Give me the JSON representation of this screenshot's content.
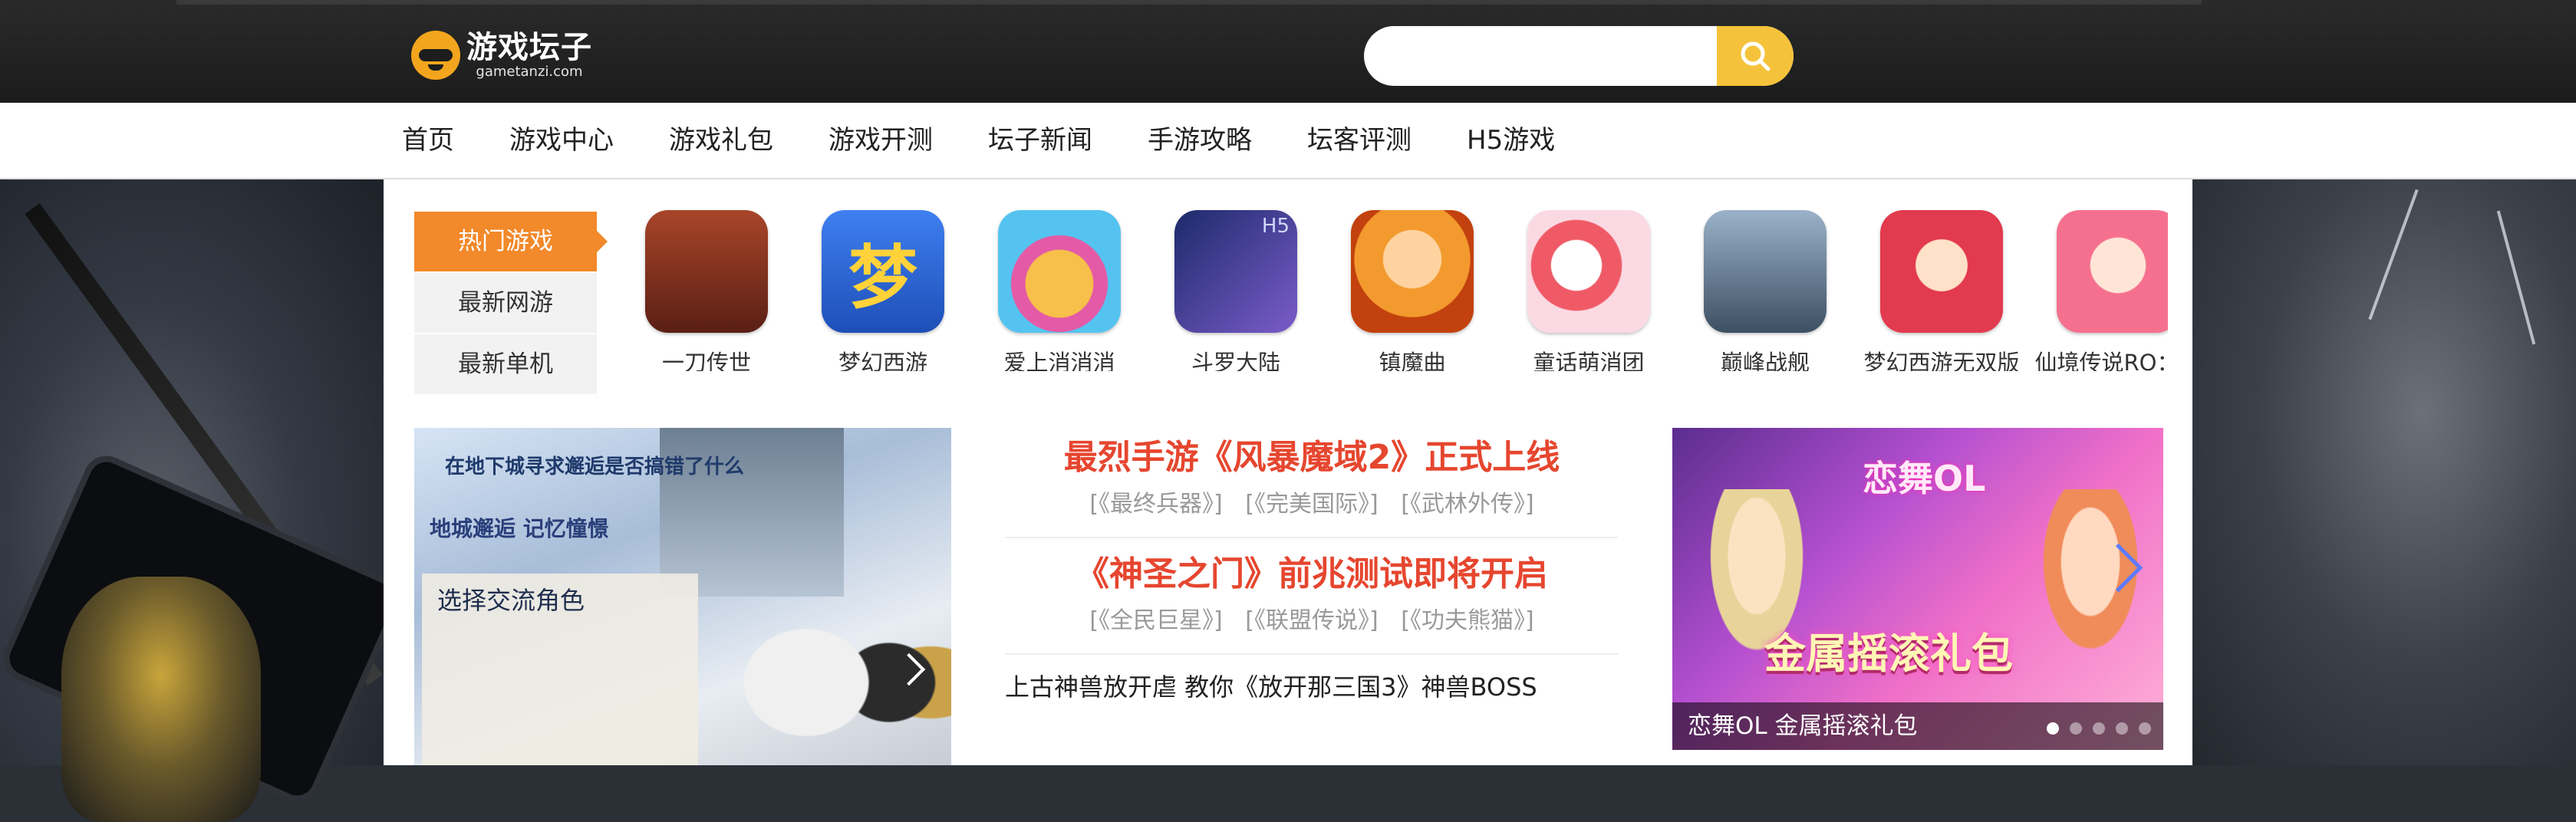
{
  "header": {
    "logo_cn": "游戏坛子",
    "logo_en": "gametanzi.com",
    "search_placeholder": ""
  },
  "nav": {
    "items": [
      "首页",
      "游戏中心",
      "游戏礼包",
      "游戏开测",
      "坛子新闻",
      "手游攻略",
      "坛客评测",
      "H5游戏"
    ]
  },
  "tabs": {
    "items": [
      "热门游戏",
      "最新网游",
      "最新单机"
    ],
    "active_index": 0
  },
  "games": [
    {
      "name": "一刀传世",
      "color": "#7a2b1a"
    },
    {
      "name": "梦幻西游",
      "color": "#2f67d6",
      "glyph": "梦"
    },
    {
      "name": "爱上消消消",
      "color": "#f3b93a"
    },
    {
      "name": "斗罗大陆",
      "color": "#3b3f8f",
      "badge": "H5"
    },
    {
      "name": "镇魔曲",
      "color": "#f08a25"
    },
    {
      "name": "童话萌消团",
      "color": "#f8d7e0"
    },
    {
      "name": "巅峰战舰",
      "color": "#4f6a86"
    },
    {
      "name": "梦幻西游无双版",
      "color": "#d9364c"
    },
    {
      "name": "仙境传说RO：守",
      "color": "#f48ca2"
    }
  ],
  "feature_image": {
    "line1": "在地下城寻求邂逅是否搞错了什么",
    "line2": "地城邂逅 记忆憧憬",
    "panel_title": "选择交流角色"
  },
  "news": {
    "headline1": "最烈手游《风暴魔域2》正式上线",
    "sub1": [
      "[《最终兵器》]",
      "[《完美国际》]",
      "[《武林外传》]"
    ],
    "headline2": "《神圣之门》前兆测试即将开启",
    "sub2": [
      "[《全民巨星》]",
      "[《联盟传说》]",
      "[《功夫熊猫》]"
    ],
    "item1": "上古神兽放开虐 教你《放开那三国3》神兽BOSS"
  },
  "slider": {
    "logo": "恋舞OL",
    "big_text": "金属摇滚礼包",
    "caption": "恋舞OL 金属摇滚礼包",
    "dot_count": 5,
    "active_dot": 0
  }
}
